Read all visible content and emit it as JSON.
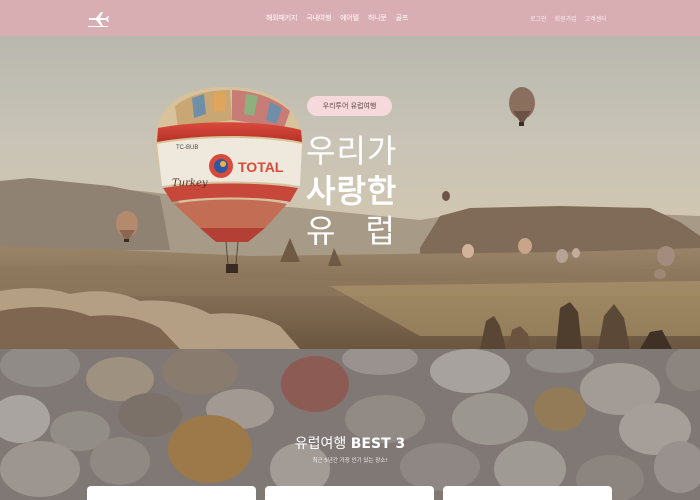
{
  "header": {
    "logo_icon": "airplane-icon",
    "nav": [
      "해외패키지",
      "국내여행",
      "에어텔",
      "허니문",
      "골프"
    ],
    "util": [
      "로그인",
      "회원가입",
      "고객센터"
    ]
  },
  "hero": {
    "badge": "우리투어 유럽여행",
    "line1": "우리가",
    "line2": "사랑한",
    "line3": "유럽"
  },
  "best": {
    "title_main": "유럽여행 ",
    "title_bold": "BEST 3",
    "subtitle": "최근 5년간 가장 인기 있는 장소!",
    "cards": 3
  },
  "balloon": {
    "brand": "TOTAL",
    "reg": "TC-BUB",
    "script": "Turkey"
  },
  "colors": {
    "header": "#d9aeb2",
    "badge": "#f6d9db"
  }
}
